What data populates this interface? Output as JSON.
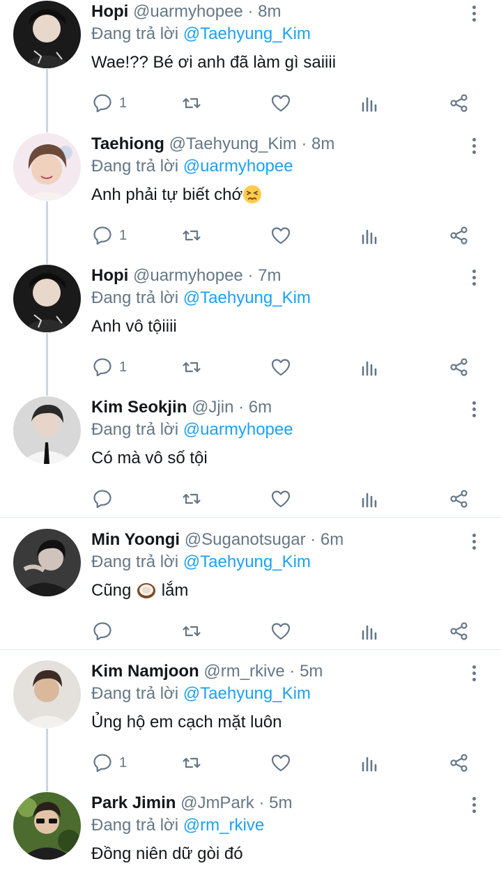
{
  "reply_prefix": "Đang trả lời",
  "separator": "·",
  "colors": {
    "mention": "#1da1f2",
    "secondary": "#657786",
    "thread_line": "#ccd6dd"
  },
  "icons": {
    "reply": "reply-icon",
    "retweet": "retweet-icon",
    "like": "heart-icon",
    "analytics": "analytics-icon",
    "share": "share-icon",
    "more": "more-vertical-icon"
  },
  "tweets": [
    {
      "name": "Hopi",
      "handle": "@uarmyhopee",
      "time": "8m",
      "reply_to": "@Taehyung_Kim",
      "text": "Wae!?? Bé ơi anh đã làm gì saiiii",
      "reply_count": "1"
    },
    {
      "name": "Taehiong",
      "handle": "@Taehyung_Kim",
      "time": "8m",
      "reply_to": "@uarmyhopee",
      "text": "Anh phải tự biết chớ",
      "emoji": "confounded-face-emoji",
      "reply_count": "1"
    },
    {
      "name": "Hopi",
      "handle": "@uarmyhopee",
      "time": "7m",
      "reply_to": "@Taehyung_Kim",
      "text": "Anh vô tộiiii",
      "reply_count": "1"
    },
    {
      "name": "Kim Seokjin",
      "handle": "@Jjin",
      "time": "6m",
      "reply_to": "@uarmyhopee",
      "text": "Có mà vô số tội",
      "reply_count": ""
    },
    {
      "name": "Min Yoongi",
      "handle": "@Suganotsugar",
      "time": "6m",
      "reply_to": "@Taehyung_Kim",
      "text_before": "Cũng",
      "emoji": "coconut-emoji",
      "text_after": "lắm",
      "reply_count": ""
    },
    {
      "name": "Kim Namjoon",
      "handle": "@rm_rkive",
      "time": "5m",
      "reply_to": "@Taehyung_Kim",
      "text": "Ủng hộ em cạch mặt luôn",
      "reply_count": "1"
    },
    {
      "name": "Park Jimin",
      "handle": "@JmPark",
      "time": "5m",
      "reply_to": "@rm_rkive",
      "text": "Đồng niên dữ gòi đó",
      "reply_count": ""
    }
  ]
}
